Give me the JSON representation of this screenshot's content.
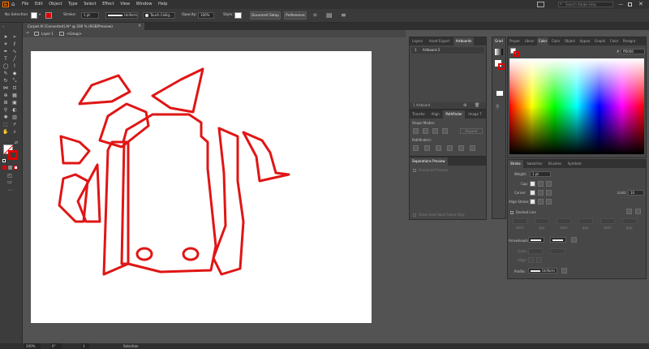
{
  "app": {
    "logo": "Ai"
  },
  "menu": [
    "File",
    "Edit",
    "Object",
    "Type",
    "Select",
    "Effect",
    "View",
    "Window",
    "Help"
  ],
  "header": {
    "search_placeholder": "Search Adobe Help"
  },
  "control": {
    "selection": "No Selection",
    "stroke_label": "Stroke:",
    "stroke_value": "1 pt",
    "profile_label": "Uniform",
    "brush_label": "Touch Callig...",
    "opacity_label": "Opacity:",
    "opacity_value": "100%",
    "style_label": "Style:",
    "doc_setup": "Document Setup",
    "preferences": "Preferences"
  },
  "document": {
    "tab_title": "Carpet AI [Converted].AI* @ 200 % (RGB/Preview)"
  },
  "breadcrumb": {
    "layer": "Layer 1",
    "group": "<Group>"
  },
  "layers_panel": {
    "tabs": [
      "Layers",
      "Asset Export",
      "Artboards"
    ],
    "active_tab": "Artboards",
    "row_number": "1",
    "row_name": "Artboard 2",
    "footer": "1 Artboard"
  },
  "pathfinder_panel": {
    "tabs": [
      "Transfor",
      "Align",
      "Pathfinder",
      "Image T"
    ],
    "active_tab": "Pathfinder",
    "shape_modes": "Shape Modes:",
    "expand": "Expand",
    "pathfinders": "Pathfinders:"
  },
  "separations_panel": {
    "title": "Separations Preview",
    "overprint": "Overprint Preview",
    "spot_colors": "Show Used Spot Colors Only"
  },
  "grad_panel": {
    "tab": "Grad"
  },
  "color_panel": {
    "tabs": [
      "Proper",
      "Librar",
      "Color",
      "Color",
      "Object",
      "Appea",
      "Graphi",
      "Color",
      "Paragra"
    ],
    "active_tab": "Color",
    "hex_prefix": "#",
    "hex_value": "ff0000"
  },
  "stroke_panel": {
    "tabs": [
      "Stroke",
      "Swatches",
      "Brushes",
      "Symbols"
    ],
    "active_tab": "Stroke",
    "weight_label": "Weight:",
    "weight_value": "1 pt",
    "cap_label": "Cap:",
    "corner_label": "Corner:",
    "limit_label": "Limit:",
    "limit_value": "10",
    "align_label": "Align Stroke:",
    "dashed_label": "Dashed Line",
    "dash_labels": [
      "dash",
      "gap",
      "dash",
      "gap",
      "dash",
      "gap"
    ],
    "arrowheads_label": "Arrowheads:",
    "scale_label": "Scale:",
    "align2_label": "Align:",
    "profile_label": "Profile:",
    "profile_value": "Uniform"
  },
  "status": {
    "zoom": "200%",
    "rotation": "0°",
    "artboard_num": "1",
    "mode": "Selection"
  },
  "colors": {
    "accent": "#e00000",
    "stroke_art": "#e01515"
  }
}
